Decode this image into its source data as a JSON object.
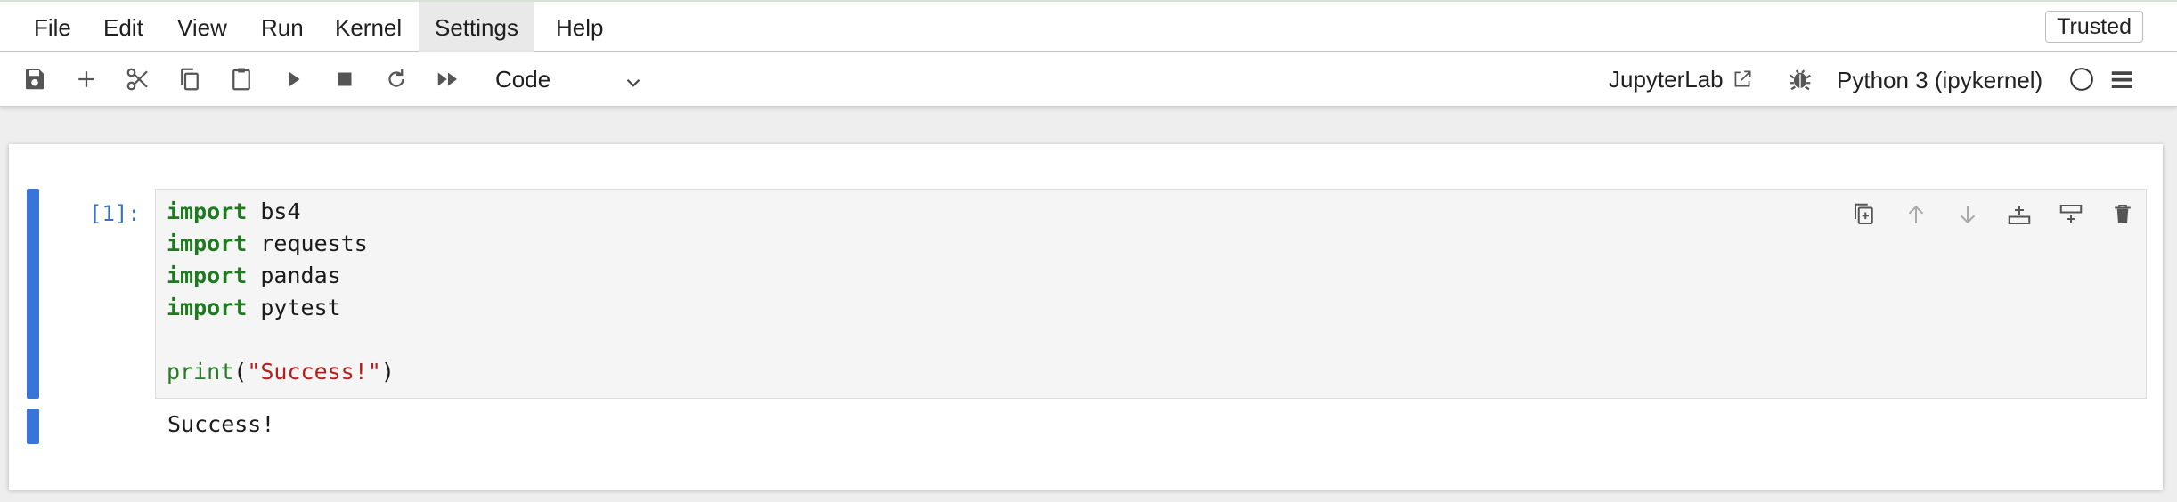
{
  "menubar": {
    "items": [
      {
        "label": "File"
      },
      {
        "label": "Edit"
      },
      {
        "label": "View"
      },
      {
        "label": "Run"
      },
      {
        "label": "Kernel"
      },
      {
        "label": "Settings"
      },
      {
        "label": "Help"
      }
    ],
    "trusted_label": "Trusted"
  },
  "toolbar": {
    "icons": [
      "save-icon",
      "add-icon",
      "cut-icon",
      "copy-icon",
      "paste-icon",
      "run-icon",
      "stop-icon",
      "restart-icon",
      "fast-forward-icon"
    ],
    "cell_type": "Code",
    "interface_link": "JupyterLab",
    "kernel_name": "Python 3 (ipykernel)"
  },
  "cell": {
    "prompt": "[1]:",
    "code_lines": [
      {
        "kw": "import",
        "rest": " bs4"
      },
      {
        "kw": "import",
        "rest": " requests"
      },
      {
        "kw": "import",
        "rest": " pandas"
      },
      {
        "kw": "import",
        "rest": " pytest"
      }
    ],
    "print_fn": "print",
    "print_open": "(",
    "print_string": "\"Success!\"",
    "print_close": ")",
    "output": "Success!",
    "tools": [
      "duplicate-icon",
      "move-up-icon",
      "move-down-icon",
      "insert-above-icon",
      "insert-below-icon",
      "delete-icon"
    ]
  },
  "colors": {
    "collapser": "#3875d7",
    "keyword": "#1e7a1e",
    "string": "#b0201f",
    "prompt": "#3770c9"
  }
}
